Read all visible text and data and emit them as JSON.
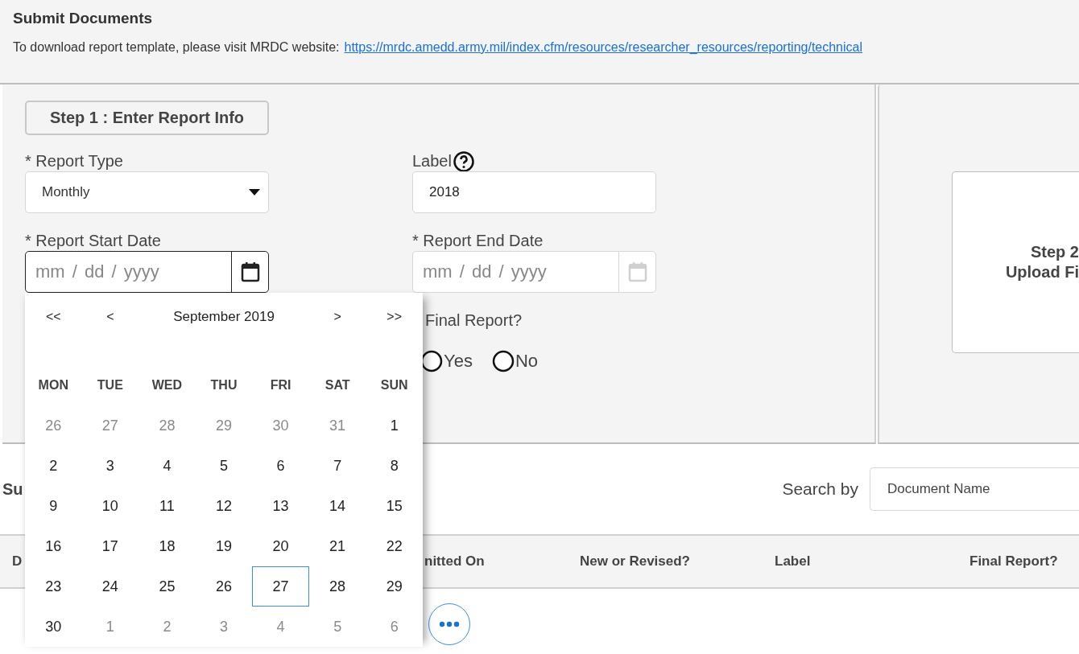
{
  "header": {
    "title": "Submit Documents",
    "intro": "To download report template, please visit MRDC website:",
    "link": "https://mrdc.amedd.army.mil/index.cfm/resources/researcher_resources/reporting/technical"
  },
  "step1": {
    "heading": "Step 1 : Enter Report Info",
    "report_type": {
      "label": "* Report Type",
      "value": "Monthly"
    },
    "label_field": {
      "label": "Label",
      "value": "2018"
    },
    "start_date": {
      "label": "* Report Start Date",
      "placeholder": "mm / dd / yyyy",
      "focused": true
    },
    "end_date": {
      "label": "* Report End Date",
      "placeholder": "mm / dd / yyyy",
      "focused": false
    },
    "final_report": {
      "label": "Final Report?",
      "options": [
        {
          "label": "Yes",
          "selected": false
        },
        {
          "label": "No",
          "selected": false
        }
      ]
    }
  },
  "calendar": {
    "first": "<<",
    "prev": "<",
    "month": "September 2019",
    "next": ">",
    "last": ">>",
    "weekdays": [
      "MON",
      "TUE",
      "WED",
      "THU",
      "FRI",
      "SAT",
      "SUN"
    ],
    "weeks": [
      [
        {
          "day": "26",
          "muted": true,
          "selected": false
        },
        {
          "day": "27",
          "muted": true,
          "selected": false
        },
        {
          "day": "28",
          "muted": true,
          "selected": false
        },
        {
          "day": "29",
          "muted": true,
          "selected": false
        },
        {
          "day": "30",
          "muted": true,
          "selected": false
        },
        {
          "day": "31",
          "muted": true,
          "selected": false
        },
        {
          "day": "1",
          "muted": false,
          "selected": false
        }
      ],
      [
        {
          "day": "2",
          "muted": false,
          "selected": false
        },
        {
          "day": "3",
          "muted": false,
          "selected": false
        },
        {
          "day": "4",
          "muted": false,
          "selected": false
        },
        {
          "day": "5",
          "muted": false,
          "selected": false
        },
        {
          "day": "6",
          "muted": false,
          "selected": false
        },
        {
          "day": "7",
          "muted": false,
          "selected": false
        },
        {
          "day": "8",
          "muted": false,
          "selected": false
        }
      ],
      [
        {
          "day": "9",
          "muted": false,
          "selected": false
        },
        {
          "day": "10",
          "muted": false,
          "selected": false
        },
        {
          "day": "11",
          "muted": false,
          "selected": false
        },
        {
          "day": "12",
          "muted": false,
          "selected": false
        },
        {
          "day": "13",
          "muted": false,
          "selected": false
        },
        {
          "day": "14",
          "muted": false,
          "selected": false
        },
        {
          "day": "15",
          "muted": false,
          "selected": false
        }
      ],
      [
        {
          "day": "16",
          "muted": false,
          "selected": false
        },
        {
          "day": "17",
          "muted": false,
          "selected": false
        },
        {
          "day": "18",
          "muted": false,
          "selected": false
        },
        {
          "day": "19",
          "muted": false,
          "selected": false
        },
        {
          "day": "20",
          "muted": false,
          "selected": false
        },
        {
          "day": "21",
          "muted": false,
          "selected": false
        },
        {
          "day": "22",
          "muted": false,
          "selected": false
        }
      ],
      [
        {
          "day": "23",
          "muted": false,
          "selected": false
        },
        {
          "day": "24",
          "muted": false,
          "selected": false
        },
        {
          "day": "25",
          "muted": false,
          "selected": false
        },
        {
          "day": "26",
          "muted": false,
          "selected": false
        },
        {
          "day": "27",
          "muted": false,
          "selected": true
        },
        {
          "day": "28",
          "muted": false,
          "selected": false
        },
        {
          "day": "29",
          "muted": false,
          "selected": false
        }
      ],
      [
        {
          "day": "30",
          "muted": false,
          "selected": false
        },
        {
          "day": "1",
          "muted": true,
          "selected": false
        },
        {
          "day": "2",
          "muted": true,
          "selected": false
        },
        {
          "day": "3",
          "muted": true,
          "selected": false
        },
        {
          "day": "4",
          "muted": true,
          "selected": false
        },
        {
          "day": "5",
          "muted": true,
          "selected": false
        },
        {
          "day": "6",
          "muted": true,
          "selected": false
        }
      ]
    ]
  },
  "step2": {
    "lines": [
      "Step 2",
      "Upload Fi"
    ]
  },
  "submissions": {
    "title": "Su",
    "search_label": "Search by",
    "search_value": "Document Name",
    "columns": [
      "D",
      "nitted On",
      "New or Revised?",
      "Label",
      "Final Report?"
    ]
  }
}
